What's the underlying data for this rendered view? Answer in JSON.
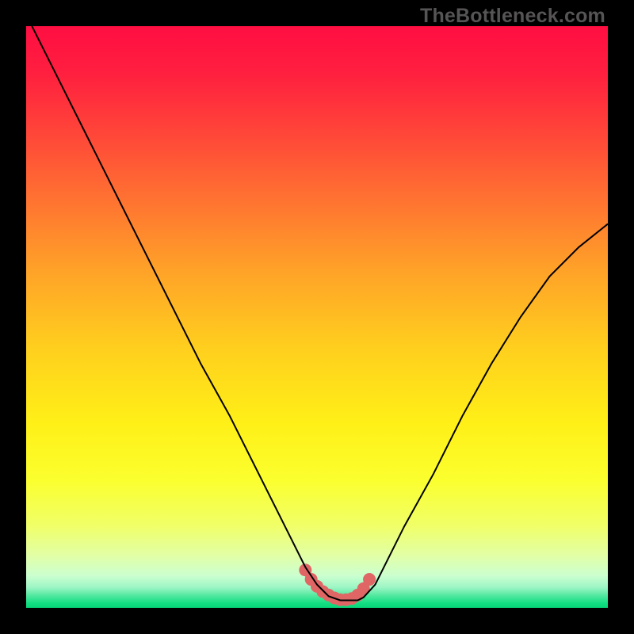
{
  "watermark": "TheBottleneck.com",
  "chart_data": {
    "type": "line",
    "title": "",
    "xlabel": "",
    "ylabel": "",
    "xlim": [
      0,
      100
    ],
    "ylim": [
      0,
      100
    ],
    "grid": false,
    "series": [
      {
        "name": "bottleneck-curve",
        "x": [
          0,
          5,
          10,
          15,
          20,
          25,
          30,
          35,
          40,
          45,
          48,
          50,
          52,
          54,
          57,
          58,
          60,
          62,
          65,
          70,
          75,
          80,
          85,
          90,
          95,
          100
        ],
        "values": [
          102,
          92,
          82,
          72,
          62,
          52,
          42,
          33,
          23,
          13,
          7,
          4,
          2,
          1.3,
          1.3,
          1.8,
          4,
          8,
          14,
          23,
          33,
          42,
          50,
          57,
          62,
          66
        ]
      },
      {
        "name": "optimum-marker",
        "x": [
          48,
          49,
          50,
          51,
          52,
          53,
          54,
          55,
          56,
          57,
          58,
          59
        ],
        "values": [
          6.5,
          4.9,
          3.7,
          2.8,
          2.2,
          1.7,
          1.4,
          1.4,
          1.6,
          2.2,
          3.3,
          4.9
        ]
      }
    ],
    "background_gradient": {
      "stops": [
        {
          "pos": 0.0,
          "color": "#ff0e42"
        },
        {
          "pos": 0.08,
          "color": "#ff1f3f"
        },
        {
          "pos": 0.18,
          "color": "#ff4439"
        },
        {
          "pos": 0.3,
          "color": "#ff7331"
        },
        {
          "pos": 0.42,
          "color": "#ffa228"
        },
        {
          "pos": 0.55,
          "color": "#ffce1e"
        },
        {
          "pos": 0.68,
          "color": "#ffef17"
        },
        {
          "pos": 0.78,
          "color": "#fbff2e"
        },
        {
          "pos": 0.86,
          "color": "#f0ff69"
        },
        {
          "pos": 0.91,
          "color": "#e2ffa6"
        },
        {
          "pos": 0.945,
          "color": "#cbffd0"
        },
        {
          "pos": 0.965,
          "color": "#9cf5c4"
        },
        {
          "pos": 0.978,
          "color": "#56e9a1"
        },
        {
          "pos": 0.992,
          "color": "#12df82"
        },
        {
          "pos": 1.0,
          "color": "#08d477"
        }
      ]
    },
    "styles": {
      "curve_color": "#000000",
      "curve_width": 2,
      "marker_color": "#e06666",
      "marker_radius": 8,
      "marker_stroke": "#e06666",
      "marker_link_width": 9
    }
  }
}
